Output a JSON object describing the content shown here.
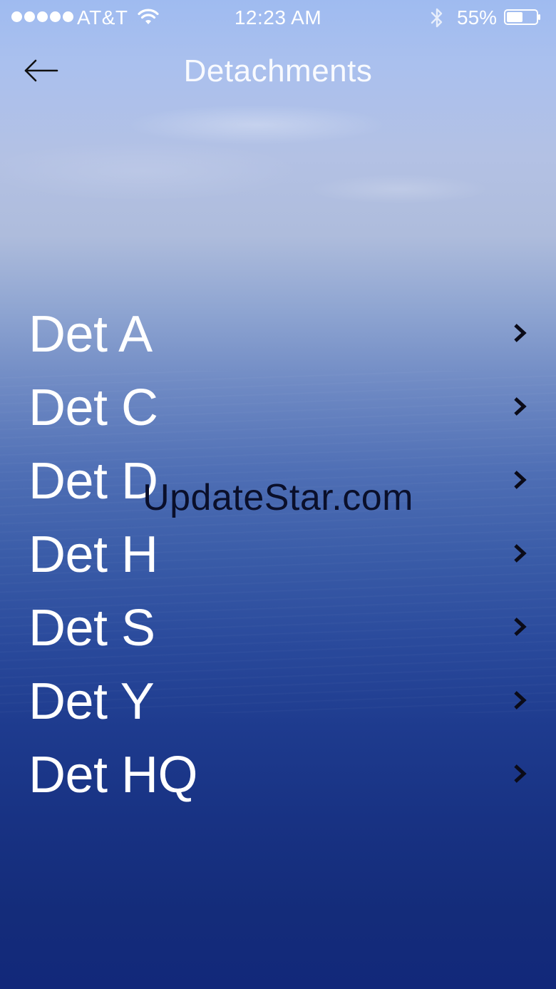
{
  "status_bar": {
    "carrier": "AT&T",
    "time": "12:23 AM",
    "battery_percent": "55%",
    "signal_bars": 5,
    "battery_level": 0.55,
    "icons": [
      "signal-dots-icon",
      "wifi-icon",
      "bluetooth-icon",
      "battery-icon"
    ]
  },
  "nav": {
    "title": "Detachments",
    "back_icon": "back-arrow-icon"
  },
  "detachments": [
    {
      "label": "Det A"
    },
    {
      "label": "Det C"
    },
    {
      "label": "Det D"
    },
    {
      "label": "Det H"
    },
    {
      "label": "Det S"
    },
    {
      "label": "Det Y"
    },
    {
      "label": "Det HQ"
    }
  ],
  "row_icon": "chevron-right-icon",
  "watermark": "UpdateStar.com",
  "colors": {
    "sky_top": "#9fbbf0",
    "sea_bottom": "#12287a",
    "text": "#ffffff",
    "chevron": "#0b0b18"
  }
}
